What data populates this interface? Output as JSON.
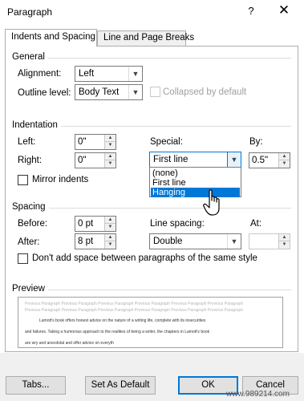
{
  "window": {
    "title": "Paragraph",
    "help_glyph": "?",
    "close_glyph": "✕"
  },
  "tabs": [
    {
      "label": "Indents and Spacing",
      "active": true
    },
    {
      "label": "Line and Page Breaks",
      "active": false
    }
  ],
  "general": {
    "title": "General",
    "alignment_label": "Alignment:",
    "alignment_value": "Left",
    "outline_label": "Outline level:",
    "outline_value": "Body Text",
    "collapsed_label": "Collapsed by default"
  },
  "indentation": {
    "title": "Indentation",
    "left_label": "Left:",
    "left_value": "0\"",
    "right_label": "Right:",
    "right_value": "0\"",
    "special_label": "Special:",
    "special_value": "First line",
    "by_label": "By:",
    "by_value": "0.5\"",
    "mirror_label": "Mirror indents",
    "special_options": [
      "(none)",
      "First line",
      "Hanging"
    ],
    "highlighted_option": "Hanging"
  },
  "spacing": {
    "title": "Spacing",
    "before_label": "Before:",
    "before_value": "0 pt",
    "after_label": "After:",
    "after_value": "8 pt",
    "line_spacing_label": "Line spacing:",
    "line_spacing_value": "Double",
    "at_label": "At:",
    "at_value": "",
    "dont_add_label": "Don't add space between paragraphs of the same style"
  },
  "preview": {
    "title": "Preview",
    "prev_lines": [
      "Previous Paragraph Previous Paragraph Previous Paragraph Previous Paragraph Previous Paragraph Previous Paragraph",
      "Previous Paragraph Previous Paragraph Previous Paragraph Previous Paragraph Previous Paragraph Previous Paragraph"
    ],
    "text_lines": [
      "Lamott's book offers honest advice on the nature of a writing life, complete with its insecurities",
      "and failures. Taking a humorous approach to the realities of being a writer, the chapters in Lamott's book",
      "are wry and anecdotal and offer advice on everyth"
    ]
  },
  "footer": {
    "tabs_label": "Tabs...",
    "set_default_label": "Set As Default",
    "ok_label": "OK",
    "cancel_label": "Cancel"
  },
  "watermark": "www.989214.com",
  "colors": {
    "accent": "#0078d7",
    "footer_bg": "#f0f0f0",
    "button_bg": "#e1e1e1"
  }
}
